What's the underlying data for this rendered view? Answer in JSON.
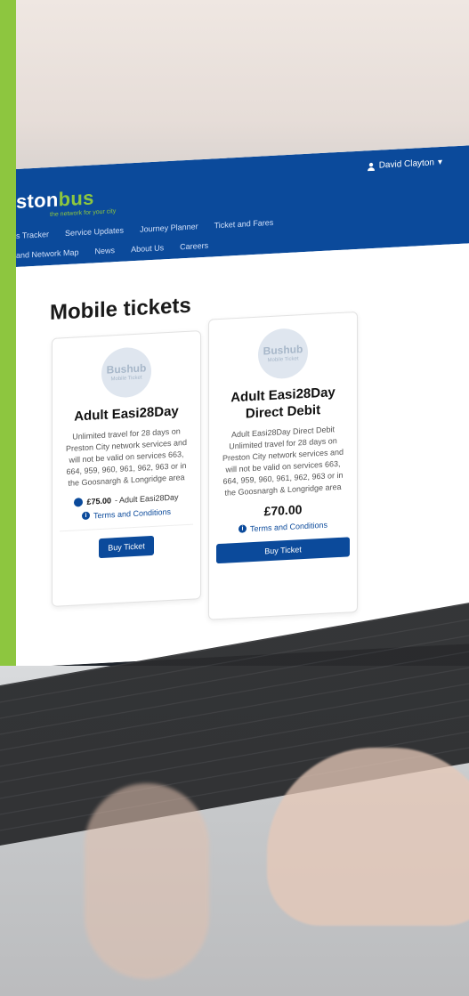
{
  "brand": {
    "logo_part1": "ston",
    "logo_part2": "bus",
    "tagline": "the network for your city"
  },
  "header": {
    "user_name": "David Clayton"
  },
  "nav": {
    "row1": [
      "s Tracker",
      "Service Updates",
      "Journey Planner",
      "Ticket and Fares"
    ],
    "row2": [
      "and Network Map",
      "News",
      "About Us",
      "Careers"
    ]
  },
  "page": {
    "title": "Mobile tickets"
  },
  "tickets": [
    {
      "badge_title": "Bushub",
      "badge_sub": "Mobile Ticket",
      "name": "Adult Easi28Day",
      "description": "Unlimited travel for 28 days on Preston City network services and will not be valid on services 663, 664, 959, 960, 961, 962, 963 or in the Goosnargh & Longridge area",
      "price_prefix": "£75.00",
      "price_suffix": " - Adult Easi28Day",
      "terms_label": "Terms and Conditions",
      "buy_label": "Buy Ticket"
    },
    {
      "badge_title": "Bushub",
      "badge_sub": "Mobile Ticket",
      "name": "Adult Easi28Day Direct Debit",
      "subtitle": "Adult Easi28Day Direct Debit",
      "description": "Unlimited travel for 28 days on Preston City network services and will not be valid on services 663, 664, 959, 960, 961, 962, 963 or in the Goosnargh & Longridge area",
      "price": "£70.00",
      "terms_label": "Terms and Conditions",
      "buy_label": "Buy Ticket"
    }
  ],
  "colors": {
    "primary": "#0b4a9b",
    "accent": "#8dc63f"
  }
}
